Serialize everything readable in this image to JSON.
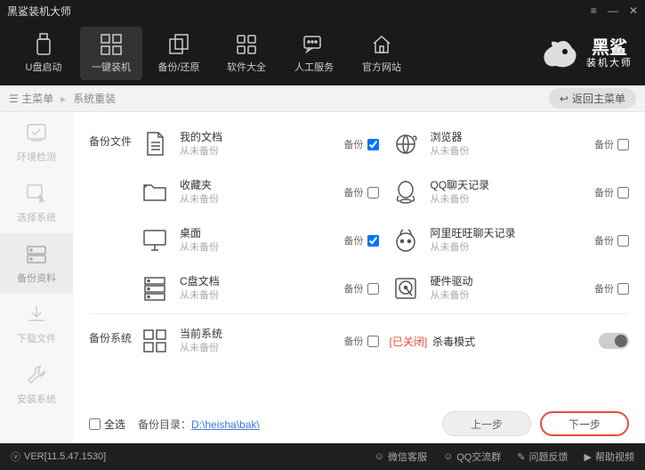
{
  "titlebar": {
    "title": "黑鲨装机大师"
  },
  "nav": {
    "items": [
      {
        "label": "U盘启动"
      },
      {
        "label": "一键装机"
      },
      {
        "label": "备份/还原"
      },
      {
        "label": "软件大全"
      },
      {
        "label": "人工服务"
      },
      {
        "label": "官方网站"
      }
    ]
  },
  "brand": {
    "line1": "黑鲨",
    "line2": "装机大师"
  },
  "crumb": {
    "root": "主菜单",
    "current": "系统重装",
    "back": "返回主菜单"
  },
  "side": {
    "items": [
      {
        "label": "环境检测"
      },
      {
        "label": "选择系统"
      },
      {
        "label": "备份资料"
      },
      {
        "label": "下载文件"
      },
      {
        "label": "安装系统"
      }
    ]
  },
  "sections": {
    "files_label": "备份文件",
    "system_label": "备份系统",
    "backup_text": "备份",
    "never": "从未备份"
  },
  "items": {
    "docs": {
      "name": "我的文档"
    },
    "browser": {
      "name": "浏览器"
    },
    "fav": {
      "name": "收藏夹"
    },
    "qq": {
      "name": "QQ聊天记录"
    },
    "desktop": {
      "name": "桌面"
    },
    "aliww": {
      "name": "阿里旺旺聊天记录"
    },
    "cdrive": {
      "name": "C盘文档"
    },
    "hw": {
      "name": "硬件驱动"
    },
    "cursys": {
      "name": "当前系统"
    }
  },
  "virus": {
    "closed": "[已关闭]",
    "label": "杀毒模式"
  },
  "bottom": {
    "select_all": "全选",
    "dir_label": "备份目录：",
    "dir_path": "D:\\heisha\\bak\\",
    "prev": "上一步",
    "next": "下一步"
  },
  "footer": {
    "version": "VER[11.5.47.1530]",
    "links": [
      "微信客服",
      "QQ交流群",
      "问题反馈",
      "帮助视频"
    ]
  }
}
